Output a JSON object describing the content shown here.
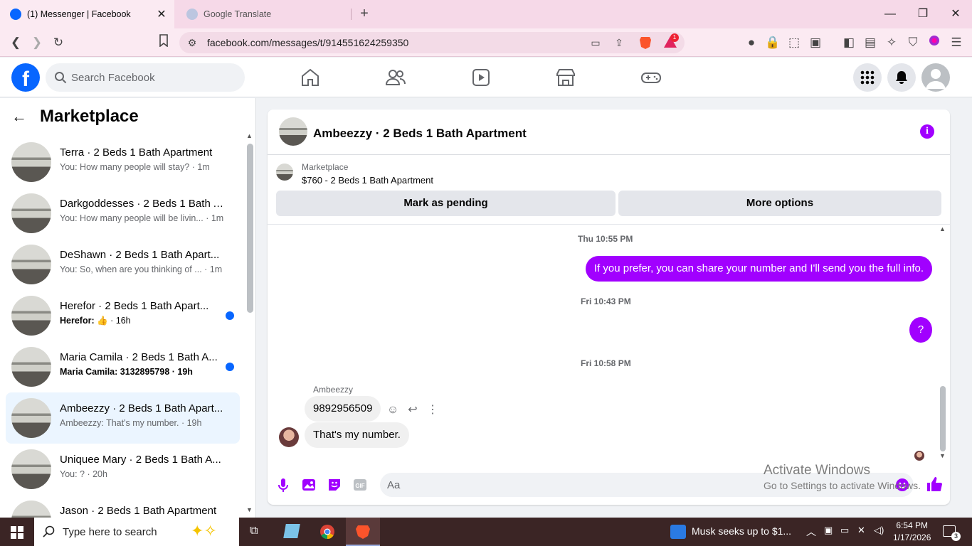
{
  "browser": {
    "tabs": [
      {
        "title": "(1) Messenger | Facebook",
        "active": true
      },
      {
        "title": "Google Translate",
        "active": false
      }
    ],
    "url": "facebook.com/messages/t/914551624259350",
    "brave_badge": "1"
  },
  "fb": {
    "search_placeholder": "Search Facebook"
  },
  "sidebar": {
    "title": "Marketplace",
    "conversations": [
      {
        "name": "Terra · 2 Beds 1 Bath Apartment",
        "preview": "You: How many people will stay? · 1m",
        "unread": false,
        "selected": false
      },
      {
        "name": "Darkgoddesses · 2 Beds 1 Bath A...",
        "preview": "You: How many people will be livin... · 1m",
        "unread": false,
        "selected": false
      },
      {
        "name": "DeShawn · 2 Beds 1 Bath Apart...",
        "preview": "You: So, when are you thinking of ... · 1m",
        "unread": false,
        "selected": false
      },
      {
        "name": "Herefor · 2 Beds 1 Bath Apart...",
        "preview_name": "Herefor:",
        "preview_time": "· 16h",
        "unread": true,
        "selected": false
      },
      {
        "name": "Maria Camila · 2 Beds 1 Bath A...",
        "preview": "Maria Camila: 3132895798 · 19h",
        "unread": true,
        "selected": false
      },
      {
        "name": "Ambeezzy · 2 Beds 1 Bath Apart...",
        "preview": "Ambeezzy: That's my number. · 19h",
        "unread": false,
        "selected": true
      },
      {
        "name": "Uniquee Mary · 2 Beds 1 Bath A...",
        "preview": "You: ? · 20h",
        "unread": false,
        "selected": false
      },
      {
        "name": "Jason · 2 Beds 1 Bath Apartment",
        "preview": "",
        "unread": false,
        "selected": false
      }
    ]
  },
  "chat": {
    "title": "Ambeezzy · 2 Beds 1 Bath Apartment",
    "marketplace_label": "Marketplace",
    "listing": "$760 - 2 Beds 1 Bath Apartment",
    "mark_pending": "Mark as pending",
    "more_options": "More options",
    "timestamps": [
      "Thu 10:55 PM",
      "Fri 10:43 PM",
      "Fri 10:58 PM"
    ],
    "outgoing_1": "If you prefer, you can share your number and I'll send you the full info.",
    "outgoing_2": "?",
    "sender": "Ambeezzy",
    "incoming_1": "9892956509",
    "incoming_2": "That's my number.",
    "composer_placeholder": "Aa",
    "accent": "#a100ff"
  },
  "watermark": {
    "line1": "Activate Windows",
    "line2": "Go to Settings to activate Windows."
  },
  "taskbar": {
    "search": "Type here to search",
    "news": "Musk seeks up to $1...",
    "time": "6:54 PM",
    "date": "1/17/2026",
    "notifications": "3"
  }
}
